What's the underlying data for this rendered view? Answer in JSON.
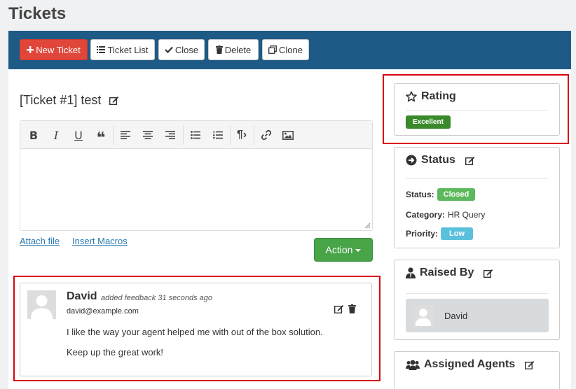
{
  "page": {
    "title": "Tickets"
  },
  "toolbar": {
    "new_ticket": "New Ticket",
    "ticket_list": "Ticket List",
    "close": "Close",
    "delete": "Delete",
    "clone": "Clone"
  },
  "ticket": {
    "title": "[Ticket #1] test"
  },
  "editor": {
    "attach_file": "Attach file",
    "insert_macros": "Insert Macros",
    "action_label": "Action"
  },
  "feedback": {
    "author": "David",
    "meta": "added feedback 31 seconds ago",
    "email": "david@example.com",
    "line1": "I like the way your agent helped me with out of the box solution.",
    "line2": "Keep up the great work!"
  },
  "rating": {
    "heading": "Rating",
    "value": "Excellent"
  },
  "status": {
    "heading": "Status",
    "status_label": "Status:",
    "status_value": "Closed",
    "category_label": "Category:",
    "category_value": "HR Query",
    "priority_label": "Priority:",
    "priority_value": "Low"
  },
  "raised_by": {
    "heading": "Raised By",
    "name": "David"
  },
  "assigned": {
    "heading": "Assigned Agents"
  },
  "colors": {
    "topbar": "#1d5b86",
    "new_ticket": "#e0463a",
    "action": "#47a447",
    "excellent": "#3a8a2b",
    "closed": "#5cb85c",
    "low": "#5bc0de",
    "highlight": "#d9000d"
  }
}
